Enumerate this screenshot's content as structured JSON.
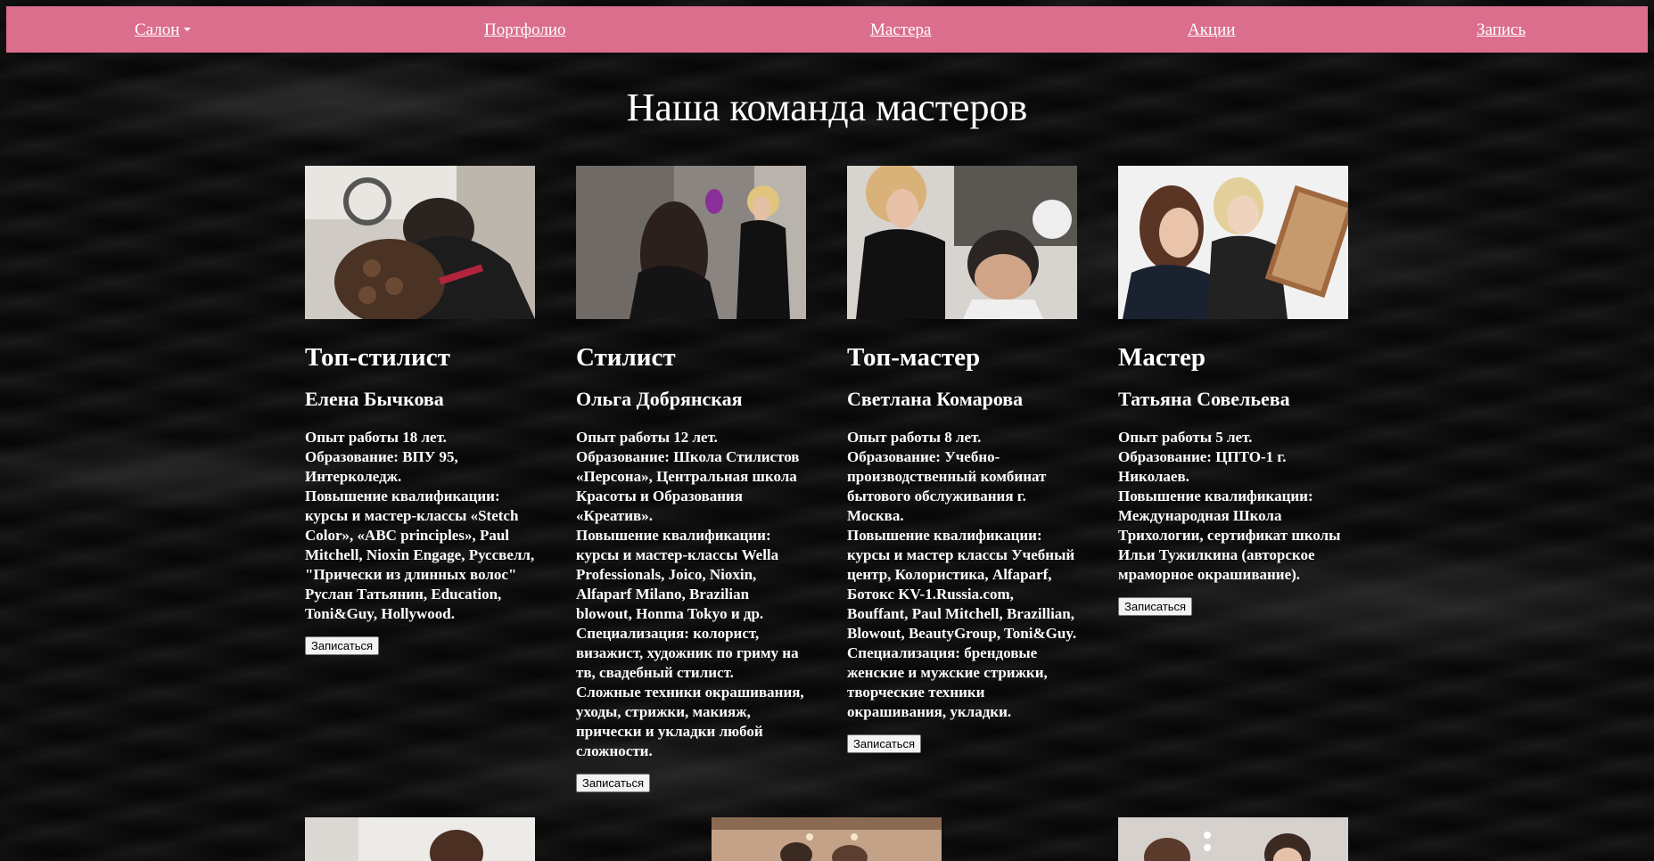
{
  "nav": {
    "items": [
      {
        "label": "Салон",
        "dropdown": true
      },
      {
        "label": "Портфолио"
      },
      {
        "label": "Мастера"
      },
      {
        "label": "Акции"
      },
      {
        "label": "Запись"
      }
    ]
  },
  "page_title": "Наша команда мастеров",
  "masters": [
    {
      "role": "Топ-стилист",
      "name": "Елена Бычкова",
      "bio": [
        "Опыт работы 18 лет.",
        "Образование: ВПУ 95, Интерколедж.",
        "Повышение квалификации: курсы и мастер-классы «Stetch Color», «ABC principles», Paul Mitchell, Nioxin Engage, Руссвелл, \"Прически из длинных волос\" Руслан Татьянин, Education, Toni&Guy, Hollywood."
      ],
      "button": "Записаться"
    },
    {
      "role": "Стилист",
      "name": "Ольга Добрянская",
      "bio": [
        "Опыт работы 12 лет.",
        "Образование: Школа Стилистов «Персона», Центральная школа Красоты и Образования «Креатив».",
        "Повышение квалификации: курсы и мастер-классы Wella Professionals, Joico, Nioxin, Alfaparf Milano, Brazilian blowout, Honma Tokyo и др.",
        "Специализация: колорист, визажист, художник по гриму на тв, свадебный стилист.",
        "Сложные техники окрашивания, уходы, стрижки, макияж, прически и укладки любой сложности."
      ],
      "button": "Записаться"
    },
    {
      "role": "Топ-мастер",
      "name": "Светлана Комарова",
      "bio": [
        "Опыт работы 8 лет.",
        "Образование: Учебно-производственный комбинат бытового обслуживания г. Москва.",
        "Повышение квалификации: курсы и мастер классы Учебный центр, Колористика, Alfaparf, Ботокс KV-1.Russia.com, Bouffant, Paul Mitchell, Brazillian, Blowout, BeautyGroup, Toni&Guy.",
        "Специализация: брендовые женские и мужские стрижки, творческие техники окрашивания, укладки."
      ],
      "button": "Записаться"
    },
    {
      "role": "Мастер",
      "name": "Татьяна Совельева",
      "bio": [
        "Опыт работы 5 лет.",
        "Образование: ЦПТО-1 г. Николаев.",
        "Повышение квалификации: Международная Школа Трихологии, сертификат школы Ильи Тужилкина (авторское мраморное окрашивание)."
      ],
      "button": "Записаться"
    }
  ],
  "colors": {
    "navbar": "#db6e8d",
    "background": "#0b0b0b",
    "text": "#ffffff"
  }
}
